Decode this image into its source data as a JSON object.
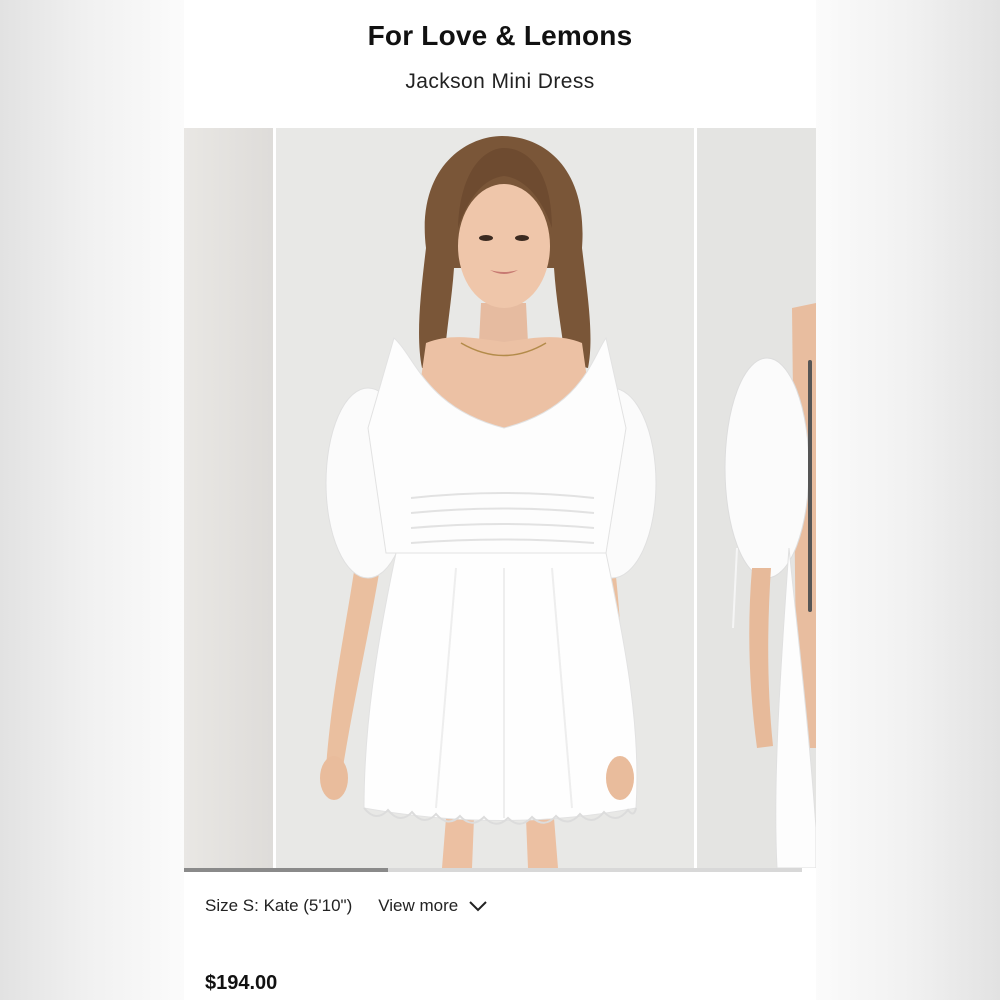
{
  "product": {
    "brand": "For Love & Lemons",
    "name": "Jackson Mini Dress",
    "price": "$194.00"
  },
  "gallery": {
    "slides": [
      {
        "description": "previous product photo"
      },
      {
        "description": "model in white puff sleeve mini dress, front view"
      },
      {
        "description": "model in white puff sleeve mini dress, side view"
      }
    ],
    "active_index": 1,
    "progress_fraction": 0.33
  },
  "details": {
    "size_label": "Size S: Kate (5'10\")",
    "view_more_label": "View more"
  },
  "icons": {
    "favorite": "heart-icon",
    "expand": "chevron-down-icon"
  },
  "colors": {
    "text": "#111111",
    "background": "#ffffff"
  }
}
